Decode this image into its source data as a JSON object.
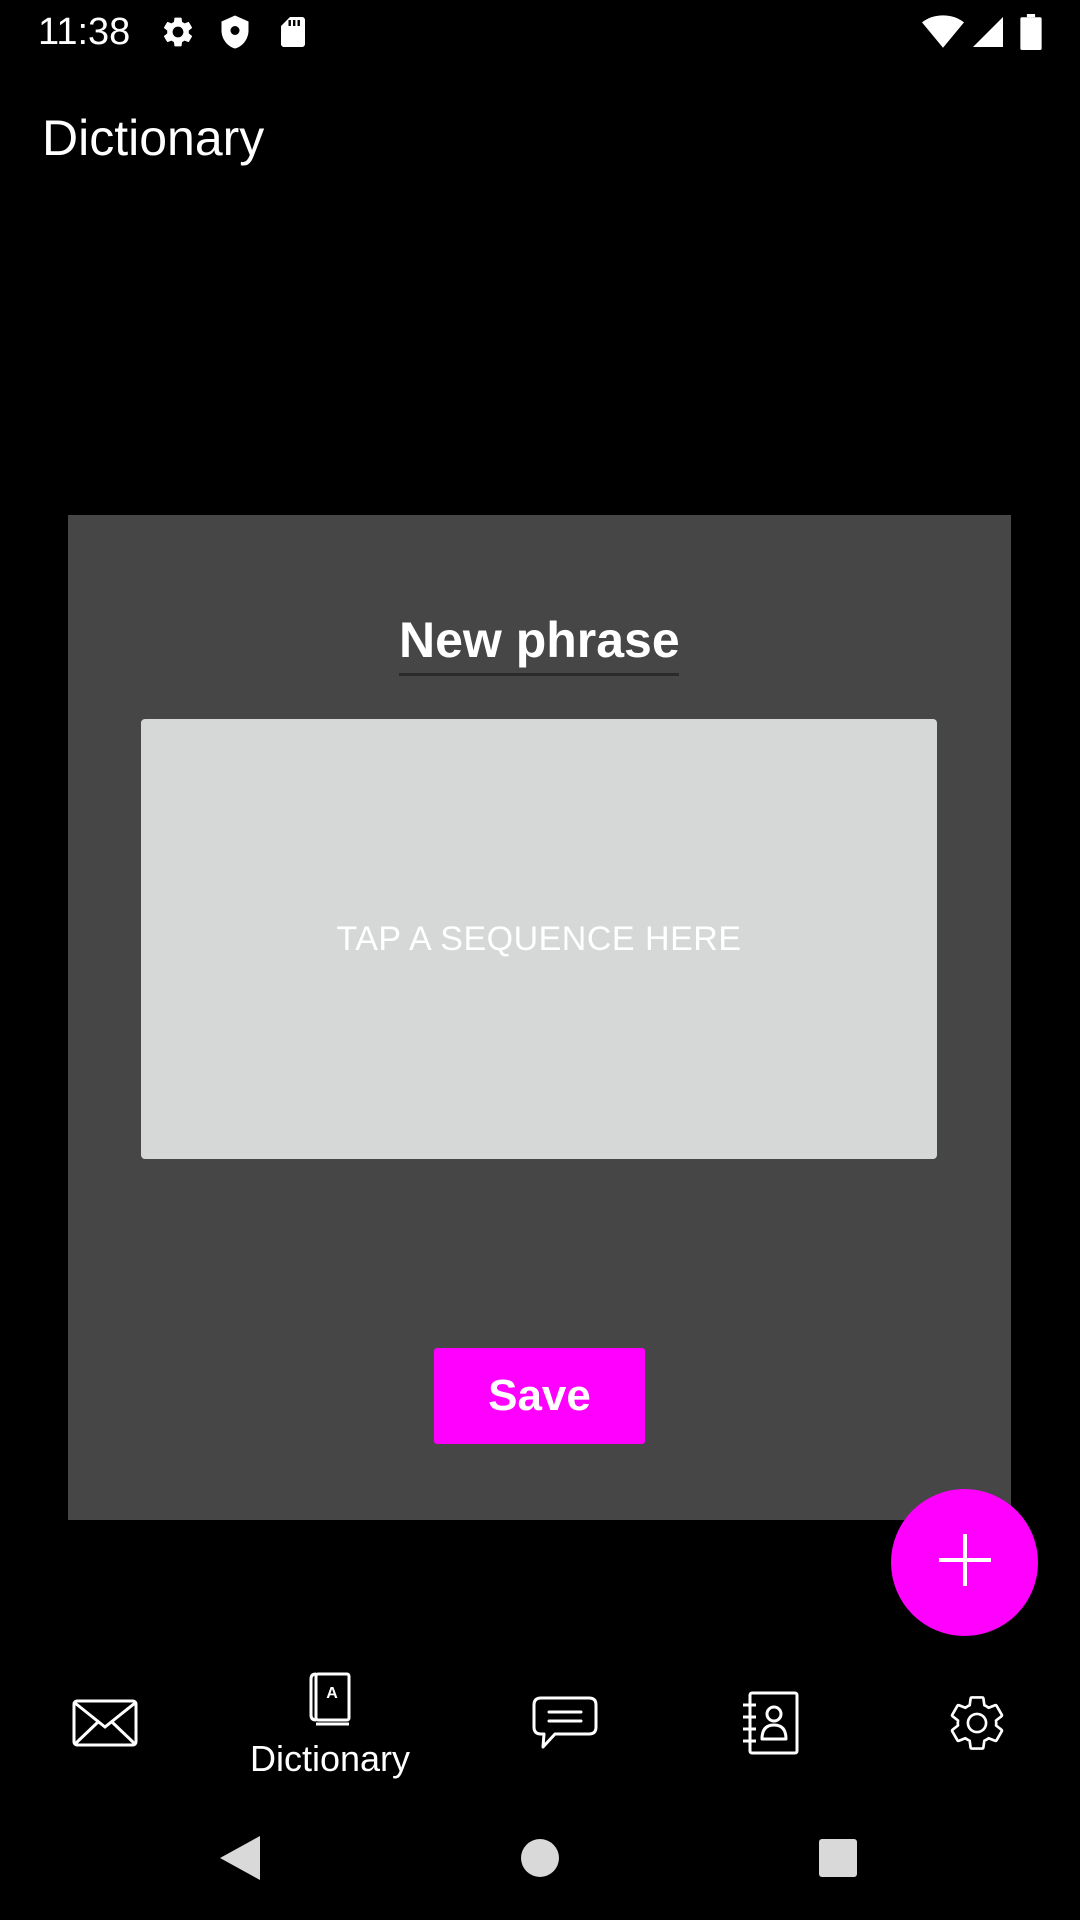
{
  "status_bar": {
    "time": "11:38",
    "left_icons": [
      "gear-icon",
      "shield-icon",
      "sd-card-icon"
    ],
    "right_icons": [
      "wifi-icon",
      "signal-icon",
      "battery-icon"
    ]
  },
  "app_bar": {
    "title": "Dictionary"
  },
  "dialog": {
    "phrase_value": "New phrase",
    "tap_area_hint": "TAP A SEQUENCE HERE",
    "save_label": "Save"
  },
  "fab": {
    "icon": "plus-icon"
  },
  "bottom_nav": {
    "items": [
      {
        "icon": "mail-icon",
        "label": ""
      },
      {
        "icon": "dictionary-icon",
        "label": "Dictionary",
        "active": true
      },
      {
        "icon": "chat-icon",
        "label": ""
      },
      {
        "icon": "contacts-icon",
        "label": ""
      },
      {
        "icon": "settings-icon",
        "label": ""
      }
    ]
  },
  "system_nav": {
    "buttons": [
      "back-icon",
      "home-icon",
      "recents-icon"
    ]
  },
  "colors": {
    "accent": "#ff00ff",
    "background": "#000000",
    "dialog": "#464646",
    "tap_area": "#d6d7d7"
  }
}
